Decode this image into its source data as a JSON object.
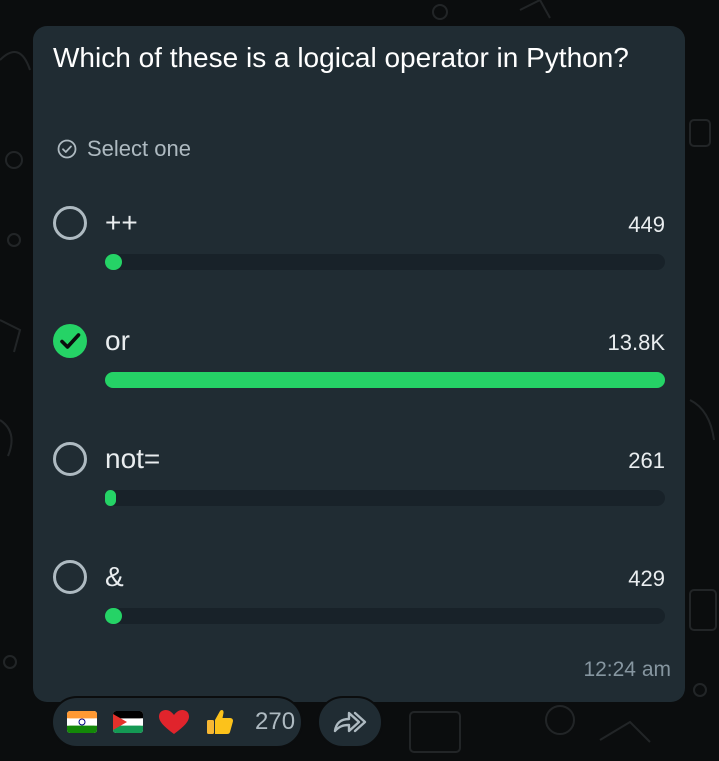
{
  "poll": {
    "question": "Which of these is a logical operator in Python?",
    "select_hint": "Select one",
    "options": [
      {
        "label": "++",
        "count": "449",
        "selected": false,
        "fraction": 0.03
      },
      {
        "label": "or",
        "count": "13.8K",
        "selected": true,
        "fraction": 1.0
      },
      {
        "label": "not=",
        "count": "261",
        "selected": false,
        "fraction": 0.019
      },
      {
        "label": "&",
        "count": "429",
        "selected": false,
        "fraction": 0.031
      }
    ],
    "timestamp": "12:24 am"
  },
  "reactions": {
    "emojis": [
      "india-flag-icon",
      "palestine-flag-icon",
      "red-heart-icon",
      "thumbs-up-icon"
    ],
    "count": "270"
  },
  "forward": {
    "icon": "forward-arrow-icon"
  },
  "colors": {
    "accent": "#25d366",
    "bubble": "#202c33",
    "background": "#0b0d0e",
    "track": "#182229"
  }
}
